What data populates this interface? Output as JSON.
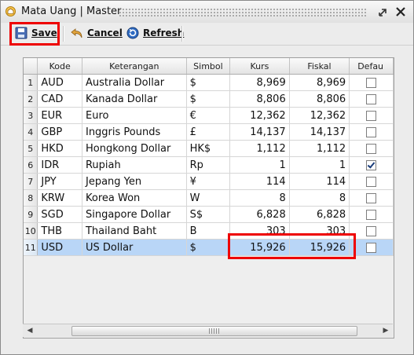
{
  "window": {
    "title": "Mata Uang | Master"
  },
  "toolbar": {
    "save": {
      "label": "Save"
    },
    "cancel": {
      "label": "Cancel"
    },
    "refresh": {
      "label": "Refresh"
    }
  },
  "grid": {
    "columns": [
      "Kode",
      "Keterangan",
      "Simbol",
      "Kurs",
      "Fiskal",
      "Defau"
    ],
    "rows": [
      {
        "no": "1",
        "kode": "AUD",
        "keterangan": "Australia Dollar",
        "simbol": "$",
        "kurs": "8,969",
        "fiskal": "8,969",
        "default": false
      },
      {
        "no": "2",
        "kode": "CAD",
        "keterangan": "Kanada Dollar",
        "simbol": "$",
        "kurs": "8,806",
        "fiskal": "8,806",
        "default": false
      },
      {
        "no": "3",
        "kode": "EUR",
        "keterangan": "Euro",
        "simbol": "€",
        "kurs": "12,362",
        "fiskal": "12,362",
        "default": false
      },
      {
        "no": "4",
        "kode": "GBP",
        "keterangan": "Inggris Pounds",
        "simbol": "£",
        "kurs": "14,137",
        "fiskal": "14,137",
        "default": false
      },
      {
        "no": "5",
        "kode": "HKD",
        "keterangan": "Hongkong Dollar",
        "simbol": "HK$",
        "kurs": "1,112",
        "fiskal": "1,112",
        "default": false
      },
      {
        "no": "6",
        "kode": "IDR",
        "keterangan": "Rupiah",
        "simbol": "Rp",
        "kurs": "1",
        "fiskal": "1",
        "default": true
      },
      {
        "no": "7",
        "kode": "JPY",
        "keterangan": "Jepang Yen",
        "simbol": "¥",
        "kurs": "114",
        "fiskal": "114",
        "default": false
      },
      {
        "no": "8",
        "kode": "KRW",
        "keterangan": "Korea Won",
        "simbol": "W",
        "kurs": "8",
        "fiskal": "8",
        "default": false
      },
      {
        "no": "9",
        "kode": "SGD",
        "keterangan": "Singapore Dollar",
        "simbol": "S$",
        "kurs": "6,828",
        "fiskal": "6,828",
        "default": false
      },
      {
        "no": "10",
        "kode": "THB",
        "keterangan": "Thailand Baht",
        "simbol": "B",
        "kurs": "303",
        "fiskal": "303",
        "default": false
      },
      {
        "no": "11",
        "kode": "USD",
        "keterangan": "US Dollar",
        "simbol": "$",
        "kurs": "15,926",
        "fiskal": "15,926",
        "default": false,
        "selected": true
      }
    ]
  },
  "colors": {
    "selected_row": "#b9d6f7",
    "highlight": "#ee0000"
  }
}
